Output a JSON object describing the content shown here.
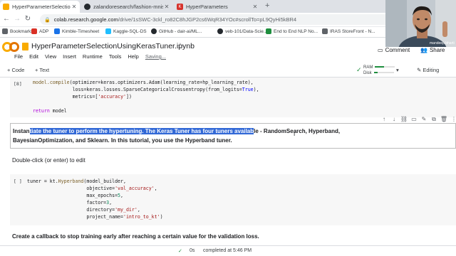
{
  "browser": {
    "tabs": [
      {
        "title": "HyperParameterSelectionUsingK",
        "active": true,
        "favicon_color": "#f9ab00"
      },
      {
        "title": "zalandoresearch/fashion-mnist",
        "active": false,
        "favicon_color": "#24292e"
      },
      {
        "title": "HyperParameters",
        "active": false,
        "favicon_color": "#d6312b"
      }
    ],
    "url_host": "colab.research.google.com",
    "url_path": "/drive/1sSWC-3ckl_ro82C8hJGP2cs6WqR34YOc#scrollTo=pL9QyHi5kBR4",
    "bookmarks": [
      {
        "label": "Bookmarks",
        "color": "#5f6368"
      },
      {
        "label": "ADP",
        "color": "#d93025"
      },
      {
        "label": "Kimble-Timesheet",
        "color": "#1a73e8"
      },
      {
        "label": "Kaggle-SQL-DS",
        "color": "#20beff"
      },
      {
        "label": "GitHub - dair-ai/ML...",
        "color": "#24292e"
      },
      {
        "label": "veb-101/Data-Scie...",
        "color": "#24292e"
      },
      {
        "label": "End to End NLP No...",
        "color": "#1e8e3e"
      },
      {
        "label": "IRAS StoreFront - N...",
        "color": "#5f6368"
      }
    ]
  },
  "colab": {
    "logo_text": "CO",
    "notebook_title": "HyperParameterSelectionUsingKerasTuner.ipynb",
    "menu": [
      "File",
      "Edit",
      "View",
      "Insert",
      "Runtime",
      "Tools",
      "Help"
    ],
    "saving_text": "Saving...",
    "comment_label": "Comment",
    "share_label": "Share",
    "toolbar": {
      "add_code": "+ Code",
      "add_text": "+ Text",
      "ram_label": "RAM",
      "disk_label": "Disk",
      "ram_usage": 0.45,
      "disk_usage": 0.2,
      "editing_label": "Editing"
    }
  },
  "cells": {
    "code1": {
      "prompt": "[8]",
      "lines": [
        "model.compile(optimizer=keras.optimizers.Adam(learning_rate=hp_learning_rate),",
        "              loss=keras.losses.SparseCategoricalCrossentropy(from_logits=True),",
        "              metrics=['accuracy'])",
        "",
        "return model"
      ]
    },
    "text1": {
      "pre": "Instan",
      "selected": "tiate the tuner to perform the hypertuning. The Keras Tuner has four tuners availab",
      "post": "le - RandomSearch, Hyperband,",
      "line2": "BayesianOptimization, and Sklearn. In this tutorial, you use the Hyperband tuner."
    },
    "text2": {
      "content": "Double-click (or enter) to edit"
    },
    "code2": {
      "prompt": "[ ]",
      "lines": [
        "tuner = kt.Hyperband(model_builder,",
        "                     objective='val_accuracy',",
        "                     max_epochs=5,",
        "                     factor=3,",
        "                     directory='my_dir',",
        "                     project_name='intro_to_kt')"
      ]
    },
    "text3": {
      "content": "Create a callback to stop training early after reaching a certain value for the validation loss."
    }
  },
  "status": {
    "check": "✓",
    "time": "0s",
    "completed": "completed at 5:46 PM"
  },
  "webcam": {
    "caption": "mandeep bharti"
  }
}
